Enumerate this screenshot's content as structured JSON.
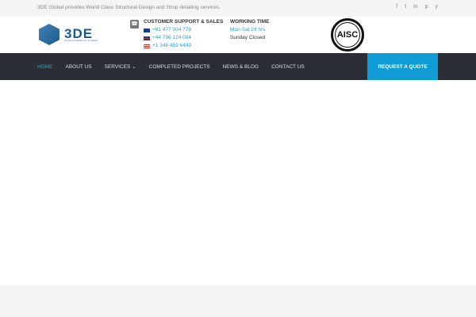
{
  "topbar": {
    "tagline": "3DE Global provides World Class Structural Design and Shop detailing services.",
    "social": [
      {
        "icon": "facebook-icon",
        "glyph": "f"
      },
      {
        "icon": "twitter-icon",
        "glyph": "t"
      },
      {
        "icon": "linkedin-icon",
        "glyph": "in"
      },
      {
        "icon": "pinterest-icon",
        "glyph": "p"
      },
      {
        "icon": "youtube-icon",
        "glyph": "y"
      }
    ]
  },
  "header": {
    "logo_text": "3DE",
    "logo_sub": "3D ENGINEERING GLOBAL",
    "support_title": "CUSTOMER SUPPORT & SALES",
    "phones": [
      {
        "flag": "australia",
        "number": "+61 477 004 776"
      },
      {
        "flag": "uk",
        "number": "+44 796 124 004"
      },
      {
        "flag": "usa",
        "number": "+1 346 459 6499"
      }
    ],
    "working_title": "WORKING TIME",
    "working_hours": "Mon-Sat 24 hrs",
    "closed": "Sunday Closed",
    "seal_text": "AISC"
  },
  "nav": {
    "items": [
      "HOME",
      "ABOUT US",
      "SERVICES",
      "COMPLETED PROJECTS",
      "NEWS & BLOG",
      "CONTACT US"
    ],
    "services_chevron": "⌄",
    "quote": "REQUEST A QUOTE"
  },
  "colors": {
    "accent": "#0e9bd6",
    "nav_bg": "#2b2f35"
  }
}
